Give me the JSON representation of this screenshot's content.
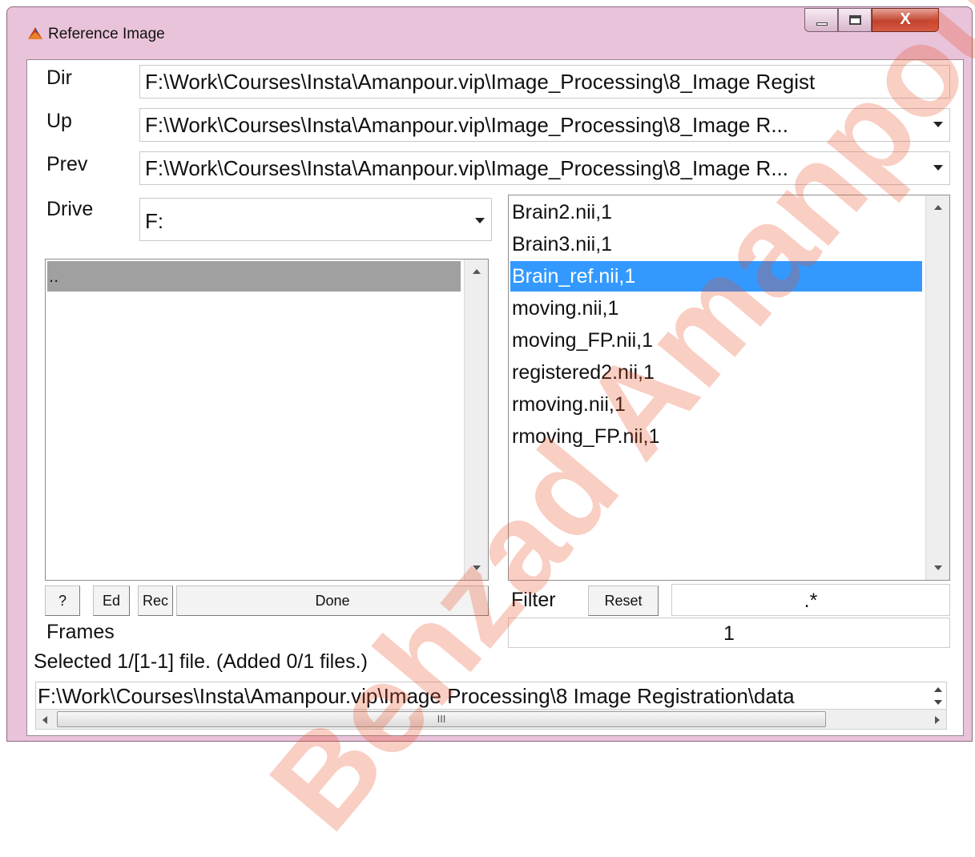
{
  "window": {
    "title": "Reference Image",
    "minimize_glyph": "",
    "maximize_glyph": "",
    "close_glyph": "X"
  },
  "labels": {
    "dir": "Dir",
    "up": "Up",
    "prev": "Prev",
    "drive": "Drive",
    "filter": "Filter",
    "frames": "Frames"
  },
  "paths": {
    "dir": "F:\\Work\\Courses\\Insta\\Amanpour.vip\\Image_Processing\\8_Image Regist",
    "up": "F:\\Work\\Courses\\Insta\\Amanpour.vip\\Image_Processing\\8_Image R...",
    "prev": "F:\\Work\\Courses\\Insta\\Amanpour.vip\\Image_Processing\\8_Image R..."
  },
  "drive": {
    "value": "F:"
  },
  "dir_list": {
    "items": [
      ".."
    ]
  },
  "file_list": {
    "items": [
      "Brain2.nii,1",
      "Brain3.nii,1",
      "Brain_ref.nii,1",
      "moving.nii,1",
      "moving_FP.nii,1",
      "registered2.nii,1",
      "rmoving.nii,1",
      "rmoving_FP.nii,1"
    ],
    "selected_index": 2
  },
  "buttons": {
    "help": "?",
    "edit": "Ed",
    "rec": "Rec",
    "done": "Done",
    "reset": "Reset"
  },
  "filter_value": ".*",
  "frames_value": "1",
  "status": "Selected 1/[1-1] file. (Added 0/1 files.)",
  "selected_path": "F:\\Work\\Courses\\Insta\\Amanpour.vip\\Image  Processing\\8  Image Registration\\data",
  "hscroll_grip": "III",
  "watermark": "Behzad Amanpour",
  "colors": {
    "titlebar": "#e9c3d9",
    "selection": "#3399ff",
    "dir_highlight": "#a0a0a0"
  }
}
